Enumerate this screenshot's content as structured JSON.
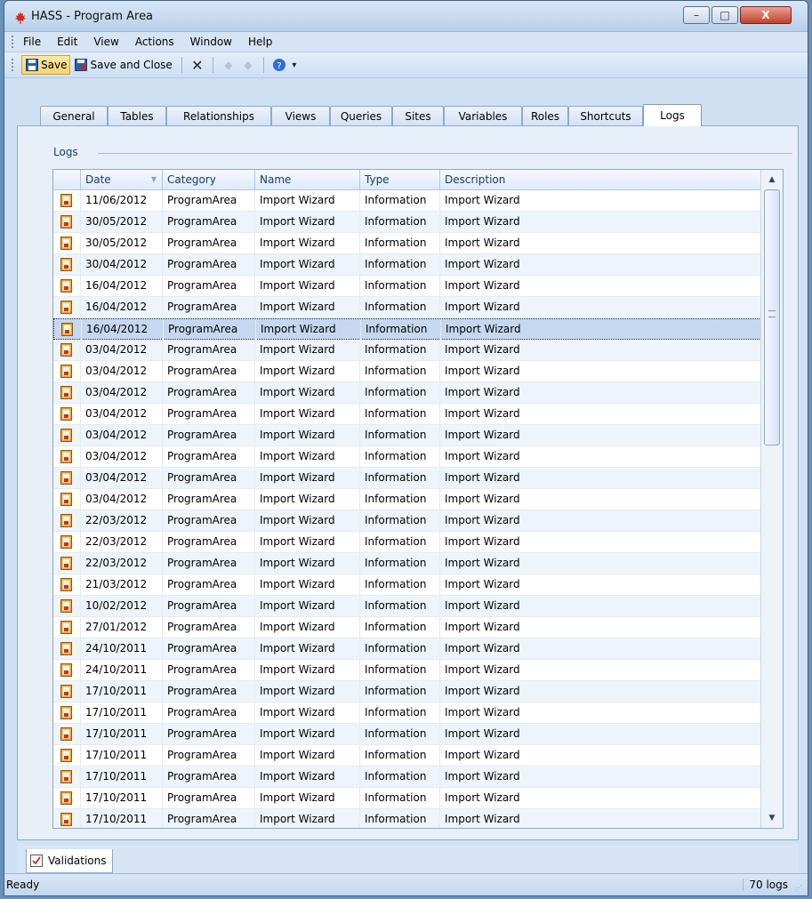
{
  "window": {
    "title": "HASS - Program Area",
    "controls": {
      "minimize": "–",
      "maximize": "□",
      "close": "X"
    }
  },
  "menu": [
    {
      "label": "File"
    },
    {
      "label": "Edit"
    },
    {
      "label": "View"
    },
    {
      "label": "Actions"
    },
    {
      "label": "Window"
    },
    {
      "label": "Help"
    }
  ],
  "toolbar": {
    "save_label": "Save",
    "save_close_label": "Save and Close"
  },
  "tabs": [
    {
      "label": "General"
    },
    {
      "label": "Tables"
    },
    {
      "label": "Relationships"
    },
    {
      "label": "Views"
    },
    {
      "label": "Queries"
    },
    {
      "label": "Sites"
    },
    {
      "label": "Variables"
    },
    {
      "label": "Roles"
    },
    {
      "label": "Shortcuts"
    },
    {
      "label": "Logs"
    }
  ],
  "active_tab": "Logs",
  "logs": {
    "group_label": "Logs",
    "columns": [
      "Date",
      "Category",
      "Name",
      "Type",
      "Description"
    ],
    "selected_row": 6,
    "rows": [
      [
        "11/06/2012",
        "ProgramArea",
        "Import Wizard",
        "Information",
        "Import Wizard"
      ],
      [
        "30/05/2012",
        "ProgramArea",
        "Import Wizard",
        "Information",
        "Import Wizard"
      ],
      [
        "30/05/2012",
        "ProgramArea",
        "Import Wizard",
        "Information",
        "Import Wizard"
      ],
      [
        "30/04/2012",
        "ProgramArea",
        "Import Wizard",
        "Information",
        "Import Wizard"
      ],
      [
        "16/04/2012",
        "ProgramArea",
        "Import Wizard",
        "Information",
        "Import Wizard"
      ],
      [
        "16/04/2012",
        "ProgramArea",
        "Import Wizard",
        "Information",
        "Import Wizard"
      ],
      [
        "16/04/2012",
        "ProgramArea",
        "Import Wizard",
        "Information",
        "Import Wizard"
      ],
      [
        "03/04/2012",
        "ProgramArea",
        "Import Wizard",
        "Information",
        "Import Wizard"
      ],
      [
        "03/04/2012",
        "ProgramArea",
        "Import Wizard",
        "Information",
        "Import Wizard"
      ],
      [
        "03/04/2012",
        "ProgramArea",
        "Import Wizard",
        "Information",
        "Import Wizard"
      ],
      [
        "03/04/2012",
        "ProgramArea",
        "Import Wizard",
        "Information",
        "Import Wizard"
      ],
      [
        "03/04/2012",
        "ProgramArea",
        "Import Wizard",
        "Information",
        "Import Wizard"
      ],
      [
        "03/04/2012",
        "ProgramArea",
        "Import Wizard",
        "Information",
        "Import Wizard"
      ],
      [
        "03/04/2012",
        "ProgramArea",
        "Import Wizard",
        "Information",
        "Import Wizard"
      ],
      [
        "03/04/2012",
        "ProgramArea",
        "Import Wizard",
        "Information",
        "Import Wizard"
      ],
      [
        "22/03/2012",
        "ProgramArea",
        "Import Wizard",
        "Information",
        "Import Wizard"
      ],
      [
        "22/03/2012",
        "ProgramArea",
        "Import Wizard",
        "Information",
        "Import Wizard"
      ],
      [
        "22/03/2012",
        "ProgramArea",
        "Import Wizard",
        "Information",
        "Import Wizard"
      ],
      [
        "21/03/2012",
        "ProgramArea",
        "Import Wizard",
        "Information",
        "Import Wizard"
      ],
      [
        "10/02/2012",
        "ProgramArea",
        "Import Wizard",
        "Information",
        "Import Wizard"
      ],
      [
        "27/01/2012",
        "ProgramArea",
        "Import Wizard",
        "Information",
        "Import Wizard"
      ],
      [
        "24/10/2011",
        "ProgramArea",
        "Import Wizard",
        "Information",
        "Import Wizard"
      ],
      [
        "24/10/2011",
        "ProgramArea",
        "Import Wizard",
        "Information",
        "Import Wizard"
      ],
      [
        "17/10/2011",
        "ProgramArea",
        "Import Wizard",
        "Information",
        "Import Wizard"
      ],
      [
        "17/10/2011",
        "ProgramArea",
        "Import Wizard",
        "Information",
        "Import Wizard"
      ],
      [
        "17/10/2011",
        "ProgramArea",
        "Import Wizard",
        "Information",
        "Import Wizard"
      ],
      [
        "17/10/2011",
        "ProgramArea",
        "Import Wizard",
        "Information",
        "Import Wizard"
      ],
      [
        "17/10/2011",
        "ProgramArea",
        "Import Wizard",
        "Information",
        "Import Wizard"
      ],
      [
        "17/10/2011",
        "ProgramArea",
        "Import Wizard",
        "Information",
        "Import Wizard"
      ],
      [
        "17/10/2011",
        "ProgramArea",
        "Import Wizard",
        "Information",
        "Import Wizard"
      ]
    ]
  },
  "bottom_tab": {
    "label": "Validations"
  },
  "status": {
    "left": "Ready",
    "right": "70 logs"
  }
}
